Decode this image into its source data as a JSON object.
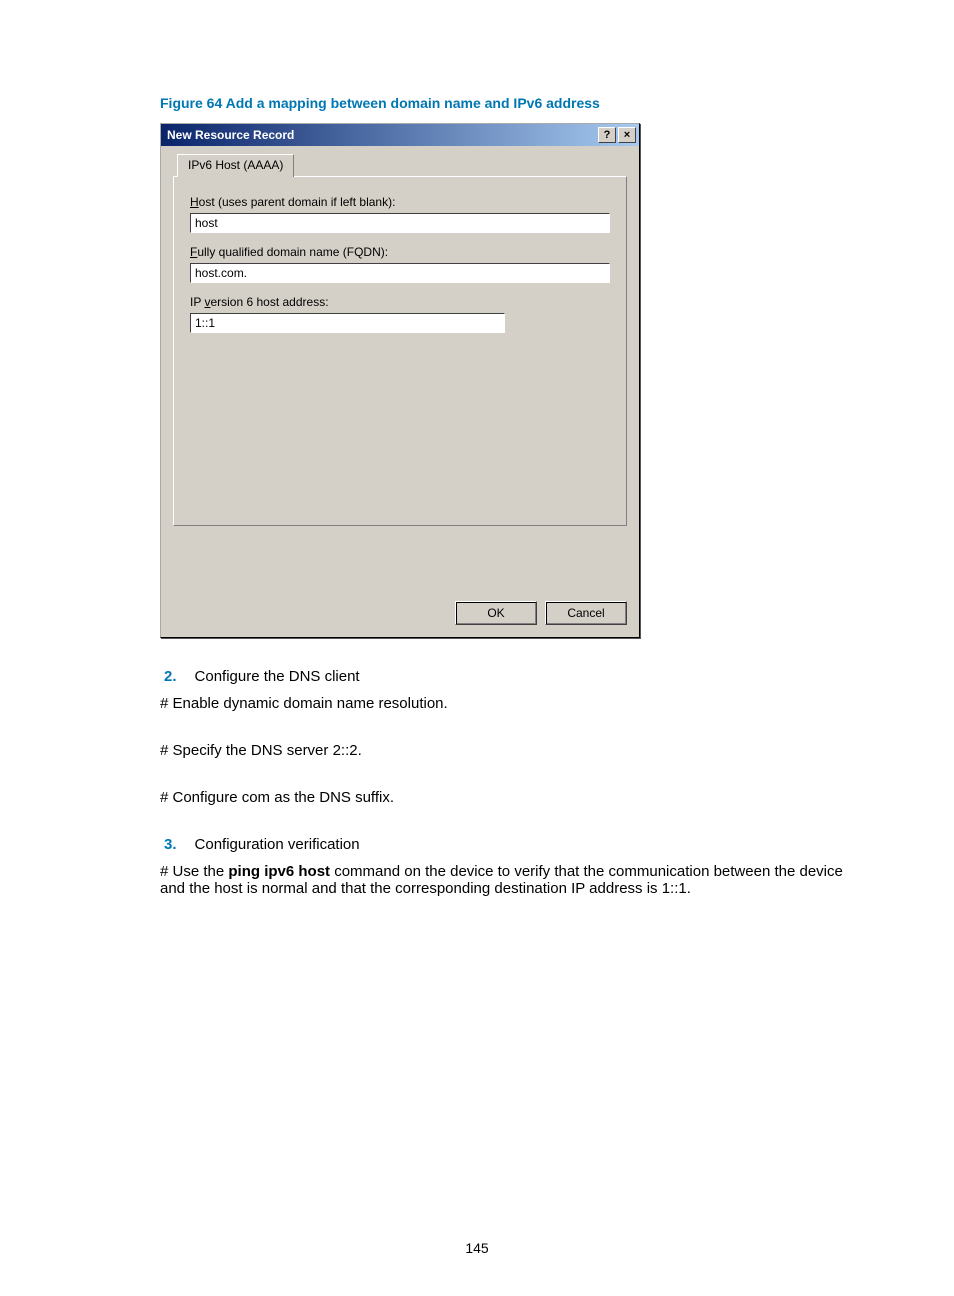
{
  "figure_caption": "Figure 64 Add a mapping between domain name and IPv6 address",
  "dialog": {
    "title": "New Resource Record",
    "help_symbol": "?",
    "close_symbol": "×",
    "tab_label": "IPv6 Host (AAAA)",
    "host_label_pre": "H",
    "host_label_rest": "ost (uses parent domain if left blank):",
    "host_value": "host",
    "fqdn_label_pre": "F",
    "fqdn_label_rest": "ully qualified domain name (FQDN):",
    "fqdn_value": "host.com.",
    "ipv6_label_pre": "IP ",
    "ipv6_label_u": "v",
    "ipv6_label_rest": "ersion 6 host address:",
    "ipv6_value": "1::1",
    "ok_label": "OK",
    "cancel_label": "Cancel"
  },
  "steps": {
    "step2_num": "2.",
    "step2_text": "Configure the DNS client",
    "hash1": "# Enable dynamic domain name resolution.",
    "hash2": "# Specify the DNS server 2::2.",
    "hash3": "# Configure com as the DNS suffix.",
    "step3_num": "3.",
    "step3_text": "Configuration verification",
    "hash4_pre": "# Use the ",
    "hash4_bold": "ping ipv6 host",
    "hash4_post": " command on the device to verify that the communication between the device and the host is normal and that the corresponding destination IP address is 1::1."
  },
  "page_number": "145"
}
